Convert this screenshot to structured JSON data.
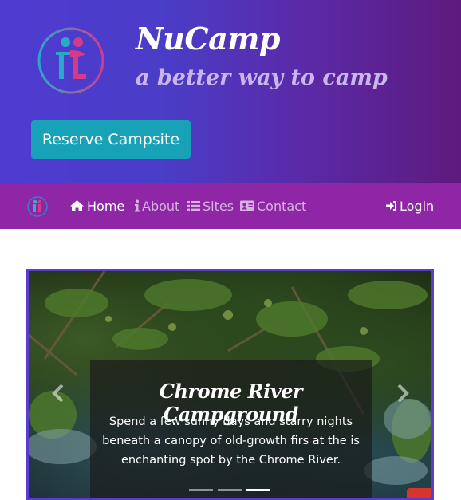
{
  "header": {
    "title": "NuCamp",
    "tagline": "a better way to camp",
    "reserve_button": "Reserve Campsite",
    "logo_icon": "nucamp-logo-icon"
  },
  "navbar": {
    "items": [
      {
        "label": "Home",
        "icon": "home-icon",
        "active": true
      },
      {
        "label": "About",
        "icon": "info-icon",
        "active": false
      },
      {
        "label": "Sites",
        "icon": "list-icon",
        "active": false
      },
      {
        "label": "Contact",
        "icon": "address-card-icon",
        "active": false
      }
    ],
    "login": "Login",
    "login_icon": "sign-in-icon"
  },
  "carousel": {
    "caption_title": "Chrome River Campground",
    "caption_text": "Spend a few sunny days and starry nights beneath a canopy of old-growth firs at the is enchanting spot by the Chrome River.",
    "slide_count": 3,
    "active_slide": 3
  },
  "colors": {
    "jumbotron_start": "#4f3bd0",
    "jumbotron_end": "#5e1a7e",
    "navbar": "#8e26a6",
    "reserve_button": "#17a2b8",
    "carousel_border": "#5b3ccf"
  }
}
